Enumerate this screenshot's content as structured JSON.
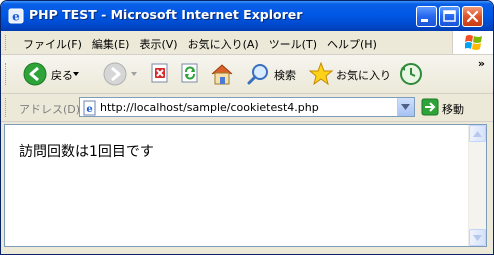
{
  "window": {
    "title": "PHP TEST - Microsoft Internet Explorer"
  },
  "menu": {
    "items": [
      {
        "label": "ファイル(F)"
      },
      {
        "label": "編集(E)"
      },
      {
        "label": "表示(V)"
      },
      {
        "label": "お気に入り(A)"
      },
      {
        "label": "ツール(T)"
      },
      {
        "label": "ヘルプ(H)"
      }
    ]
  },
  "toolbar": {
    "back_label": "戻る",
    "search_label": "検索",
    "favorites_label": "お気に入り",
    "more_label": "»"
  },
  "address": {
    "label": "アドレス(D)",
    "url": "http://localhost/sample/cookietest4.php",
    "go_label": "移動"
  },
  "content": {
    "text": "訪問回数は1回目です"
  },
  "colors": {
    "titlebar": "#0058e6",
    "close_button": "#e0532a",
    "window_face": "#ece9d8"
  },
  "icons": {
    "title": "ie-icon",
    "back": "back-arrow-icon",
    "forward": "forward-arrow-icon",
    "stop": "stop-icon",
    "refresh": "refresh-icon",
    "home": "home-icon",
    "search": "search-icon",
    "favorites": "star-icon",
    "history": "history-icon",
    "page": "page-icon",
    "go": "go-arrow-icon"
  }
}
